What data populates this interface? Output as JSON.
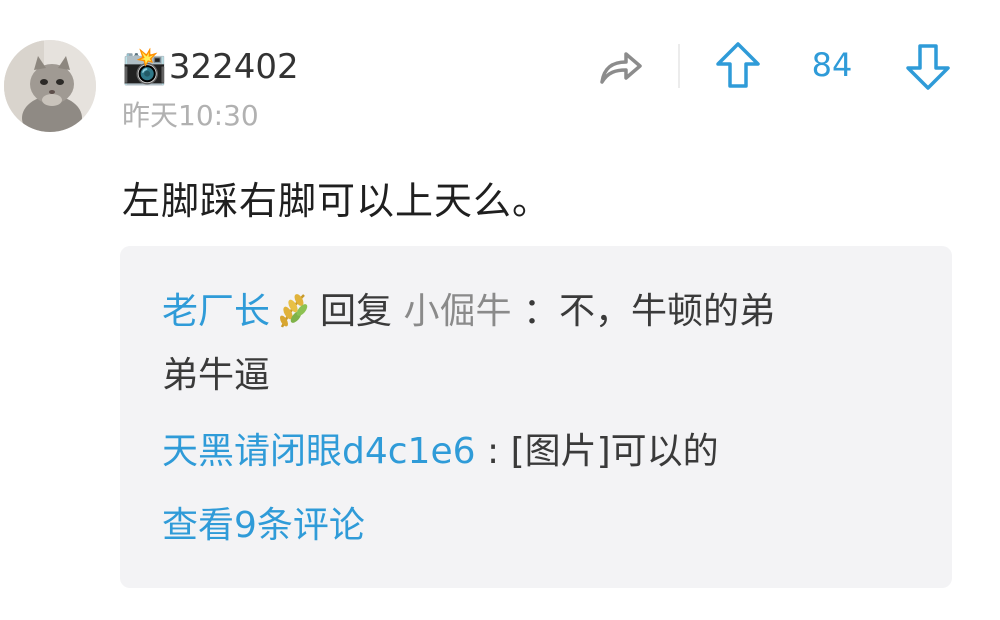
{
  "post": {
    "username": "322402",
    "username_icon": "camera-flash-emoji",
    "timestamp": "昨天10:30",
    "text": "左脚踩右脚可以上天么。"
  },
  "actions": {
    "share_icon": "share-arrow-icon",
    "upvote_icon": "upvote-arrow-icon",
    "vote_count": "84",
    "downvote_icon": "downvote-arrow-icon"
  },
  "replies": {
    "reply1": {
      "author": "老厂长",
      "badge_icon": "wheat-badge-icon",
      "verb": "回复",
      "target": "小倔牛",
      "colon": "：",
      "text_line1": "不，牛顿的弟",
      "text_line2": "弟牛逼"
    },
    "reply2": {
      "author": "天黑请闭眼d4c1e6",
      "colon": ":",
      "text": "[图片]可以的"
    },
    "view_more": "查看9条评论"
  },
  "colors": {
    "accent": "#2f9bd8",
    "reply_bg": "#f3f3f5",
    "timestamp": "#b1b1b1"
  }
}
